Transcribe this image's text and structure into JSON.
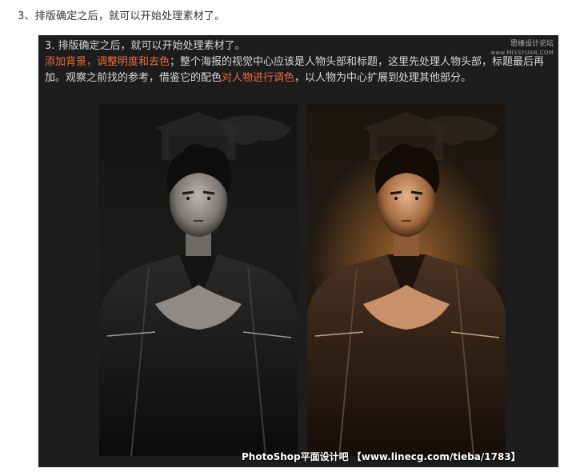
{
  "step": {
    "heading": "3、排版确定之后，就可以开始处理素材了。"
  },
  "panel": {
    "line1": "3. 排版确定之后，就可以开始处理素材了。",
    "highlight1": "添加背景，调整明度和去色",
    "text1": "；整个海报的视觉中心应该是人物头部和标题，这里先处理人物头部，标题最后再加。观察之前找的参考，借鉴它的配色",
    "highlight2": "对人物进行调色",
    "text2": "，以人物为中心扩展到处理其他部分。",
    "watermark_name": "思缘设计论坛",
    "watermark_site": "www.MISSYUAN.COM",
    "caption": "PhotoShop平面设计吧 【www.linecg.com/tieba/1783】"
  },
  "images": {
    "left": "portrait-desaturated",
    "right": "portrait-color-graded"
  },
  "colors": {
    "highlight": "#f06a3c",
    "panel_bg": "#1d1d1d",
    "warm_glow": "#e08a3a"
  }
}
